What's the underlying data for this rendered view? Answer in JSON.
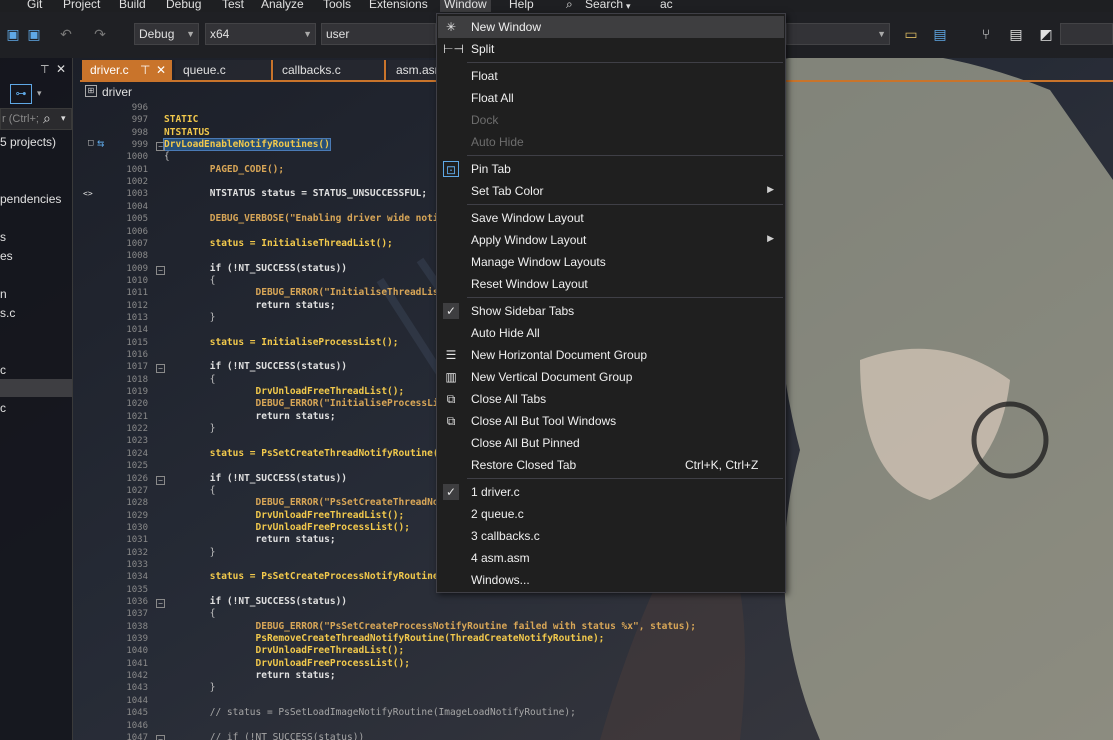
{
  "menubar": {
    "items": [
      "Git",
      "Project",
      "Build",
      "Debug",
      "Test",
      "Analyze",
      "Tools",
      "Extensions",
      "Window",
      "Help",
      "Search",
      "ac"
    ]
  },
  "toolbar": {
    "config": "Debug",
    "platform": "x64",
    "profile": "user"
  },
  "leftpane": {
    "search_placeholder": "r (Ctrl+;",
    "items": [
      "5 projects)",
      "pendencies",
      "s",
      "es",
      "n",
      "s.c",
      "c",
      "c"
    ]
  },
  "tabs": [
    "driver.c",
    "queue.c",
    "callbacks.c",
    "asm.asm"
  ],
  "pin_glyph": "⊤",
  "close_glyph": "✕",
  "breadcrumb": "driver",
  "code": {
    "lines": [
      {
        "n": "996",
        "t": ""
      },
      {
        "n": "997",
        "t": "STATIC"
      },
      {
        "n": "998",
        "t": "NTSTATUS"
      },
      {
        "n": "999",
        "t": "DrvLoadEnableNotifyRoutines()"
      },
      {
        "n": "1000",
        "t": "{"
      },
      {
        "n": "1001",
        "t": "        PAGED_CODE();"
      },
      {
        "n": "1002",
        "t": ""
      },
      {
        "n": "1003",
        "t": "        NTSTATUS status = STATUS_UNSUCCESSFUL;"
      },
      {
        "n": "1004",
        "t": ""
      },
      {
        "n": "1005",
        "t": "        DEBUG_VERBOSE(\"Enabling driver wide noti"
      },
      {
        "n": "1006",
        "t": ""
      },
      {
        "n": "1007",
        "t": "        status = InitialiseThreadList();"
      },
      {
        "n": "1008",
        "t": ""
      },
      {
        "n": "1009",
        "t": "        if (!NT_SUCCESS(status))"
      },
      {
        "n": "1010",
        "t": "        {"
      },
      {
        "n": "1011",
        "t": "                DEBUG_ERROR(\"InitialiseThreadLis"
      },
      {
        "n": "1012",
        "t": "                return status;"
      },
      {
        "n": "1013",
        "t": "        }"
      },
      {
        "n": "1014",
        "t": ""
      },
      {
        "n": "1015",
        "t": "        status = InitialiseProcessList();"
      },
      {
        "n": "1016",
        "t": ""
      },
      {
        "n": "1017",
        "t": "        if (!NT_SUCCESS(status))"
      },
      {
        "n": "1018",
        "t": "        {"
      },
      {
        "n": "1019",
        "t": "                DrvUnloadFreeThreadList();"
      },
      {
        "n": "1020",
        "t": "                DEBUG_ERROR(\"InitialiseProcessLi"
      },
      {
        "n": "1021",
        "t": "                return status;"
      },
      {
        "n": "1022",
        "t": "        }"
      },
      {
        "n": "1023",
        "t": ""
      },
      {
        "n": "1024",
        "t": "        status = PsSetCreateThreadNotifyRoutine("
      },
      {
        "n": "1025",
        "t": ""
      },
      {
        "n": "1026",
        "t": "        if (!NT_SUCCESS(status))"
      },
      {
        "n": "1027",
        "t": "        {"
      },
      {
        "n": "1028",
        "t": "                DEBUG_ERROR(\"PsSetCreateThreadNo"
      },
      {
        "n": "1029",
        "t": "                DrvUnloadFreeThreadList();"
      },
      {
        "n": "1030",
        "t": "                DrvUnloadFreeProcessList();"
      },
      {
        "n": "1031",
        "t": "                return status;"
      },
      {
        "n": "1032",
        "t": "        }"
      },
      {
        "n": "1033",
        "t": ""
      },
      {
        "n": "1034",
        "t": "        status = PsSetCreateProcessNotifyRoutine"
      },
      {
        "n": "1035",
        "t": ""
      },
      {
        "n": "1036",
        "t": "        if (!NT_SUCCESS(status))"
      },
      {
        "n": "1037",
        "t": "        {"
      },
      {
        "n": "1038",
        "t": "                DEBUG_ERROR(\"PsSetCreateProcessNotifyRoutine failed with status %x\", status);"
      },
      {
        "n": "1039",
        "t": "                PsRemoveCreateThreadNotifyRoutine(ThreadCreateNotifyRoutine);"
      },
      {
        "n": "1040",
        "t": "                DrvUnloadFreeThreadList();"
      },
      {
        "n": "1041",
        "t": "                DrvUnloadFreeProcessList();"
      },
      {
        "n": "1042",
        "t": "                return status;"
      },
      {
        "n": "1043",
        "t": "        }"
      },
      {
        "n": "1044",
        "t": ""
      },
      {
        "n": "1045",
        "t": "        // status = PsSetLoadImageNotifyRoutine(ImageLoadNotifyRoutine);"
      },
      {
        "n": "1046",
        "t": ""
      },
      {
        "n": "1047",
        "t": "        // if (!NT_SUCCESS(status))"
      }
    ]
  },
  "window_menu": {
    "items": [
      {
        "label": "New Window",
        "icon": "new-window-icon",
        "glyph": "✳",
        "highlighted": true
      },
      {
        "label": "Split",
        "icon": "split-icon",
        "glyph": "⊢⊣"
      },
      {
        "sep": true
      },
      {
        "label": "Float"
      },
      {
        "label": "Float All"
      },
      {
        "label": "Dock",
        "disabled": true
      },
      {
        "label": "Auto Hide",
        "disabled": true
      },
      {
        "sep": true
      },
      {
        "label": "Pin Tab",
        "icon": "pin-icon",
        "glyph": "⊡"
      },
      {
        "label": "Set Tab Color",
        "submenu": true
      },
      {
        "sep": true
      },
      {
        "label": "Save Window Layout"
      },
      {
        "label": "Apply Window Layout",
        "submenu": true
      },
      {
        "label": "Manage Window Layouts"
      },
      {
        "label": "Reset Window Layout"
      },
      {
        "sep": true
      },
      {
        "label": "Show Sidebar Tabs",
        "icon": "check-icon",
        "glyph": "✓"
      },
      {
        "label": "Auto Hide All"
      },
      {
        "label": "New Horizontal Document Group",
        "icon": "horizontal-group-icon",
        "glyph": "☰"
      },
      {
        "label": "New Vertical Document Group",
        "icon": "vertical-group-icon",
        "glyph": "▥"
      },
      {
        "label": "Close All Tabs",
        "icon": "close-all-icon",
        "glyph": "⧉"
      },
      {
        "label": "Close All But Tool Windows",
        "icon": "close-all-but-tool-icon",
        "glyph": "⧉"
      },
      {
        "label": "Close All But Pinned"
      },
      {
        "label": "Restore Closed Tab",
        "shortcut": "Ctrl+K, Ctrl+Z"
      },
      {
        "sep": true
      },
      {
        "label": "1 driver.c",
        "icon": "check-icon",
        "glyph": "✓"
      },
      {
        "label": "2 queue.c"
      },
      {
        "label": "3 callbacks.c"
      },
      {
        "label": "4 asm.asm"
      },
      {
        "label": "Windows..."
      }
    ],
    "submenu_glyph": "▶"
  },
  "colors": {
    "accent": "#c9742b",
    "menu_bg": "#1f1f1f",
    "highlight": "#3e3e40"
  }
}
